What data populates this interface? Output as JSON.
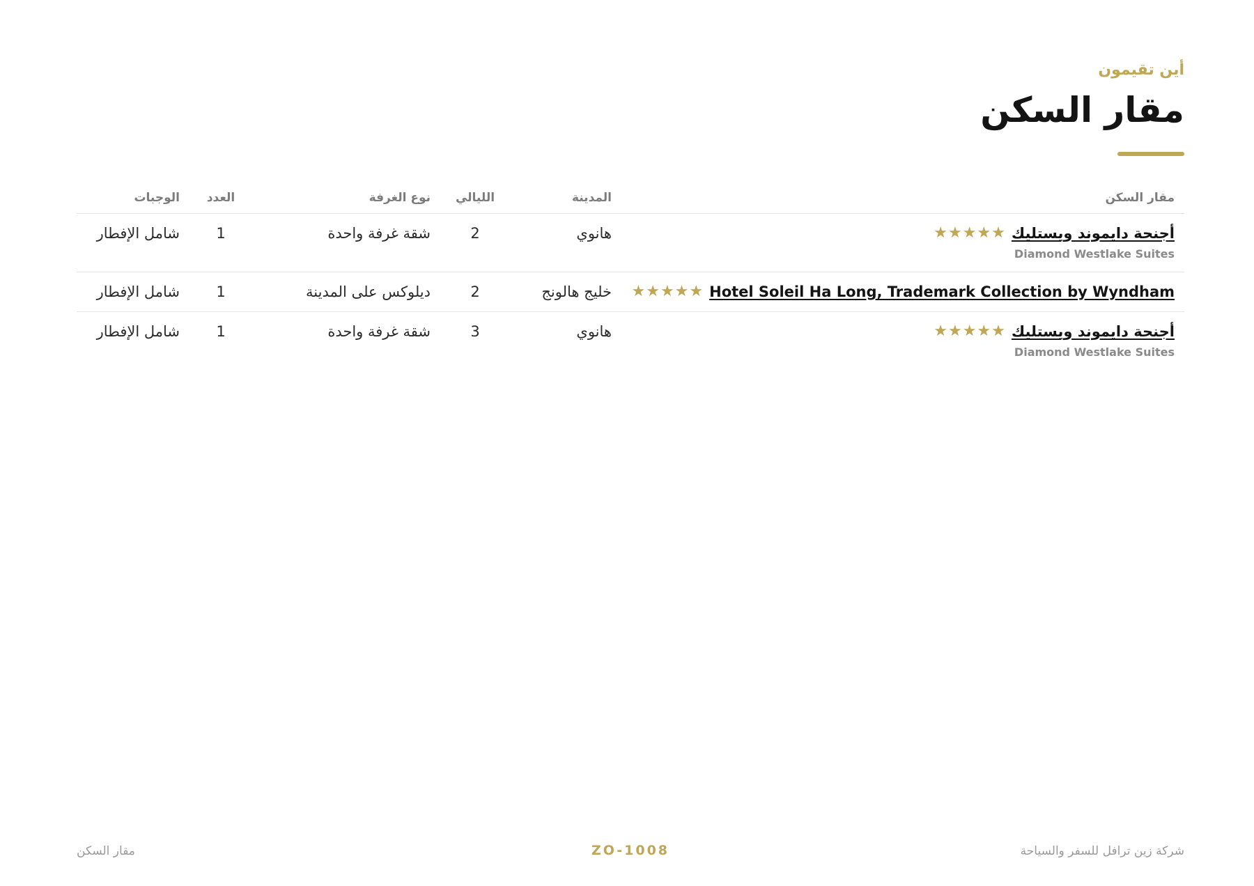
{
  "section": {
    "eyebrow": "أين تقيمون",
    "title": "مقار السكن"
  },
  "table": {
    "headers": {
      "hotel": "مقار السكن",
      "city": "المدينة",
      "nights": "الليالي",
      "room_type": "نوع الغرفة",
      "count": "العدد",
      "meals": "الوجبات"
    },
    "rows": [
      {
        "hotel": "أجنحة دايموند ويستليك",
        "hotel_sub": "Diamond Westlake Suites",
        "stars": "★★★★★",
        "rating": 5,
        "city": "هانوي",
        "nights": "2",
        "room_type": "شقة غرفة واحدة",
        "count": "1",
        "meals": "شامل الإفطار"
      },
      {
        "hotel": "Hotel Soleil Ha Long, Trademark Collection by Wyndham",
        "stars": "★★★★★",
        "rating": 5,
        "city": "خليج هالونج",
        "nights": "2",
        "room_type": "ديلوكس على المدينة",
        "count": "1",
        "meals": "شامل الإفطار"
      },
      {
        "hotel": "أجنحة دايموند ويستليك",
        "hotel_sub": "Diamond Westlake Suites",
        "stars": "★★★★★",
        "rating": 5,
        "city": "هانوي",
        "nights": "3",
        "room_type": "شقة غرفة واحدة",
        "count": "1",
        "meals": "شامل الإفطار"
      }
    ]
  },
  "footer": {
    "company": "شركة زين ترافل للسفر والسياحة",
    "code": "ZO-1008",
    "section": "مقار السكن"
  },
  "colors": {
    "accent": "#bfa756",
    "text": "#141414",
    "muted": "#8a8a8a"
  }
}
